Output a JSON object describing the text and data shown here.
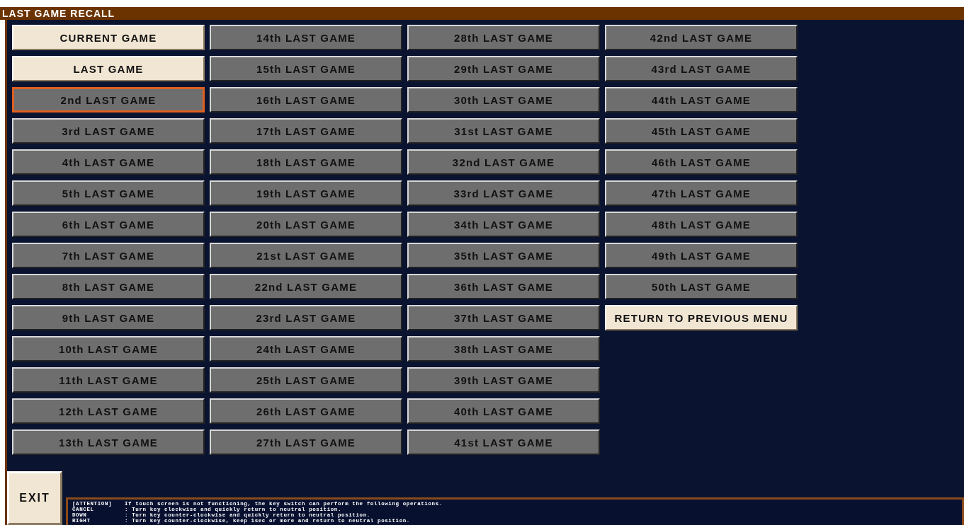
{
  "window": {
    "title": "LAST GAME RECALL"
  },
  "columns": [
    [
      {
        "label": "CURRENT GAME",
        "kind": "light",
        "selected": false
      },
      {
        "label": "LAST GAME",
        "kind": "light",
        "selected": false
      },
      {
        "label": "2nd LAST GAME",
        "kind": "dark",
        "selected": true
      },
      {
        "label": "3rd LAST GAME",
        "kind": "dark",
        "selected": false
      },
      {
        "label": "4th LAST GAME",
        "kind": "dark",
        "selected": false
      },
      {
        "label": "5th LAST GAME",
        "kind": "dark",
        "selected": false
      },
      {
        "label": "6th LAST GAME",
        "kind": "dark",
        "selected": false
      },
      {
        "label": "7th LAST GAME",
        "kind": "dark",
        "selected": false
      },
      {
        "label": "8th LAST GAME",
        "kind": "dark",
        "selected": false
      },
      {
        "label": "9th LAST GAME",
        "kind": "dark",
        "selected": false
      },
      {
        "label": "10th LAST GAME",
        "kind": "dark",
        "selected": false
      },
      {
        "label": "11th LAST GAME",
        "kind": "dark",
        "selected": false
      },
      {
        "label": "12th LAST GAME",
        "kind": "dark",
        "selected": false
      },
      {
        "label": "13th LAST GAME",
        "kind": "dark",
        "selected": false
      }
    ],
    [
      {
        "label": "14th LAST GAME",
        "kind": "dark",
        "selected": false
      },
      {
        "label": "15th LAST GAME",
        "kind": "dark",
        "selected": false
      },
      {
        "label": "16th LAST GAME",
        "kind": "dark",
        "selected": false
      },
      {
        "label": "17th LAST GAME",
        "kind": "dark",
        "selected": false
      },
      {
        "label": "18th LAST GAME",
        "kind": "dark",
        "selected": false
      },
      {
        "label": "19th LAST GAME",
        "kind": "dark",
        "selected": false
      },
      {
        "label": "20th LAST GAME",
        "kind": "dark",
        "selected": false
      },
      {
        "label": "21st LAST GAME",
        "kind": "dark",
        "selected": false
      },
      {
        "label": "22nd LAST GAME",
        "kind": "dark",
        "selected": false
      },
      {
        "label": "23rd LAST GAME",
        "kind": "dark",
        "selected": false
      },
      {
        "label": "24th LAST GAME",
        "kind": "dark",
        "selected": false
      },
      {
        "label": "25th LAST GAME",
        "kind": "dark",
        "selected": false
      },
      {
        "label": "26th LAST GAME",
        "kind": "dark",
        "selected": false
      },
      {
        "label": "27th LAST GAME",
        "kind": "dark",
        "selected": false
      }
    ],
    [
      {
        "label": "28th LAST GAME",
        "kind": "dark",
        "selected": false
      },
      {
        "label": "29th LAST GAME",
        "kind": "dark",
        "selected": false
      },
      {
        "label": "30th LAST GAME",
        "kind": "dark",
        "selected": false
      },
      {
        "label": "31st LAST GAME",
        "kind": "dark",
        "selected": false
      },
      {
        "label": "32nd LAST GAME",
        "kind": "dark",
        "selected": false
      },
      {
        "label": "33rd LAST GAME",
        "kind": "dark",
        "selected": false
      },
      {
        "label": "34th LAST GAME",
        "kind": "dark",
        "selected": false
      },
      {
        "label": "35th LAST GAME",
        "kind": "dark",
        "selected": false
      },
      {
        "label": "36th LAST GAME",
        "kind": "dark",
        "selected": false
      },
      {
        "label": "37th LAST GAME",
        "kind": "dark",
        "selected": false
      },
      {
        "label": "38th LAST GAME",
        "kind": "dark",
        "selected": false
      },
      {
        "label": "39th LAST GAME",
        "kind": "dark",
        "selected": false
      },
      {
        "label": "40th LAST GAME",
        "kind": "dark",
        "selected": false
      },
      {
        "label": "41st LAST GAME",
        "kind": "dark",
        "selected": false
      }
    ],
    [
      {
        "label": "42nd LAST GAME",
        "kind": "dark",
        "selected": false
      },
      {
        "label": "43rd LAST GAME",
        "kind": "dark",
        "selected": false
      },
      {
        "label": "44th LAST GAME",
        "kind": "dark",
        "selected": false
      },
      {
        "label": "45th LAST GAME",
        "kind": "dark",
        "selected": false
      },
      {
        "label": "46th LAST GAME",
        "kind": "dark",
        "selected": false
      },
      {
        "label": "47th LAST GAME",
        "kind": "dark",
        "selected": false
      },
      {
        "label": "48th LAST GAME",
        "kind": "dark",
        "selected": false
      },
      {
        "label": "49th LAST GAME",
        "kind": "dark",
        "selected": false
      },
      {
        "label": "50th LAST GAME",
        "kind": "dark",
        "selected": false
      },
      {
        "label": "RETURN TO PREVIOUS MENU",
        "kind": "light",
        "selected": false
      }
    ]
  ],
  "exit_button": {
    "label": "EXIT"
  },
  "notice": [
    {
      "key": "[ATTENTION]",
      "text": "If touch screen is not functioning, the key switch can perform the following operations."
    },
    {
      "key": "CANCEL",
      "text": ": Turn key clockwise and quickly return to neutral position."
    },
    {
      "key": "DOWN",
      "text": ": Turn key counter-clockwise and quickly return to neutral position."
    },
    {
      "key": "RIGHT",
      "text": ": Turn key counter-clockwise, keep 1sec or more and return to neutral position."
    }
  ]
}
